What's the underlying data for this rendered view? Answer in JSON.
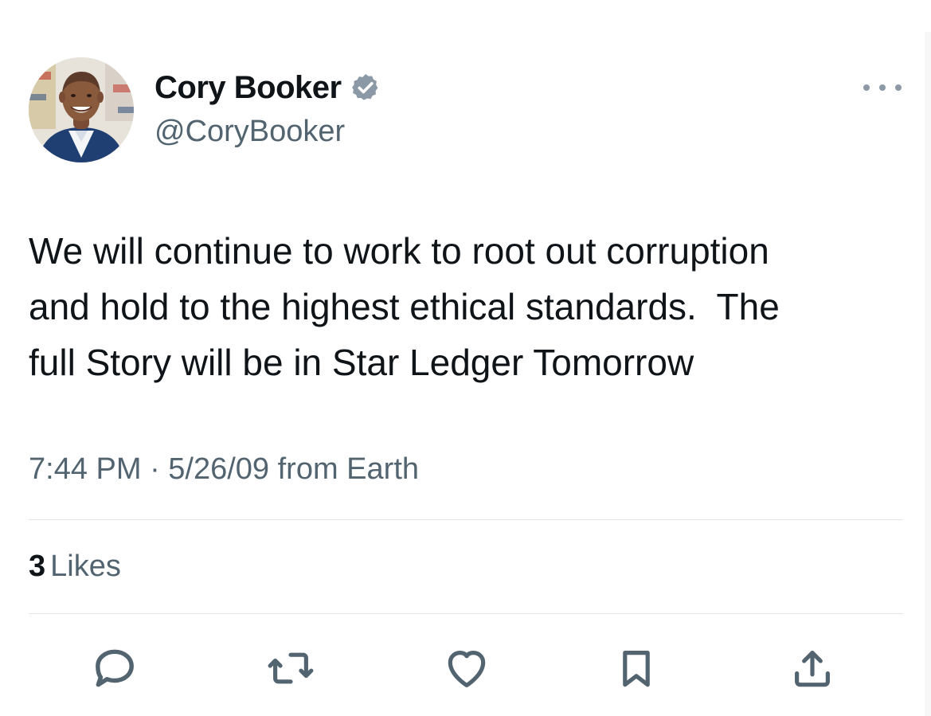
{
  "author": {
    "display_name": "Cory Booker",
    "handle": "@CoryBooker",
    "verified_icon": "verified-badge-icon",
    "verified_color": "#8b98a5"
  },
  "tweet": {
    "text": "We will continue to work to root out corruption\nand hold to the highest ethical standards.  The\nfull Story will be in Star Ledger Tomorrow",
    "meta": "7:44 PM · 5/26/09 from Earth"
  },
  "engagement": {
    "likes_count": "3",
    "likes_label": "Likes"
  },
  "actions": [
    {
      "name": "reply",
      "icon": "reply-icon"
    },
    {
      "name": "retweet",
      "icon": "retweet-icon"
    },
    {
      "name": "like",
      "icon": "heart-icon"
    },
    {
      "name": "bookmark",
      "icon": "bookmark-icon"
    },
    {
      "name": "share",
      "icon": "share-icon"
    }
  ],
  "colors": {
    "primary_text": "#0f1419",
    "secondary_text": "#536471",
    "icon": "#536471",
    "divider": "#e1e6ea"
  }
}
